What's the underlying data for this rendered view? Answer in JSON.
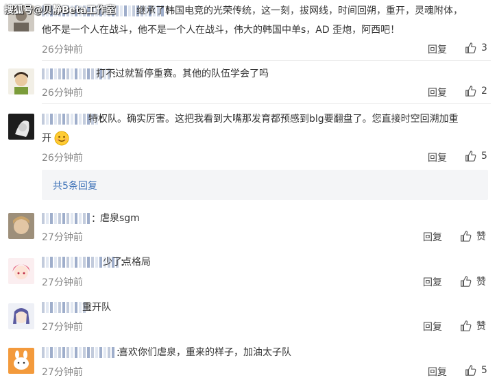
{
  "watermark": "搜狐号@贝静Beta工作室",
  "more_replies": "共5条回复",
  "reply_label": "回复",
  "like_icon": "thumbs-up-icon",
  "comments": [
    {
      "text_line1": "继承了韩国电竞的光荣传统，这一刻，拔网线，时间回朔，重开，灵魂附体，",
      "text_line2": "他不是一个人在战斗，他不是一个人在战斗，伟大的韩国中单s，AD 歪炮，阿西吧！",
      "time": "26分钟前",
      "likes": "3"
    },
    {
      "text": "打不过就暂停重赛。其他的队伍学会了吗",
      "time": "26分钟前",
      "likes": "2"
    },
    {
      "text_line1": "特权队。确实厉害。这把我看到大嘴那发育都预感到blg要翻盘了。您直接时空回溯加重",
      "text_line2": "开",
      "time": "26分钟前",
      "likes": "5"
    },
    {
      "text": "虐泉sgm",
      "time": "27分钟前",
      "likes": "赞"
    },
    {
      "text": "少了点格局",
      "time": "27分钟前",
      "likes": "赞"
    },
    {
      "text": "重开队",
      "time": "27分钟前",
      "likes": "赞"
    },
    {
      "text": "喜欢你们虐泉，重来的样子，加油太子队",
      "time": "27分钟前",
      "likes": "5"
    }
  ]
}
